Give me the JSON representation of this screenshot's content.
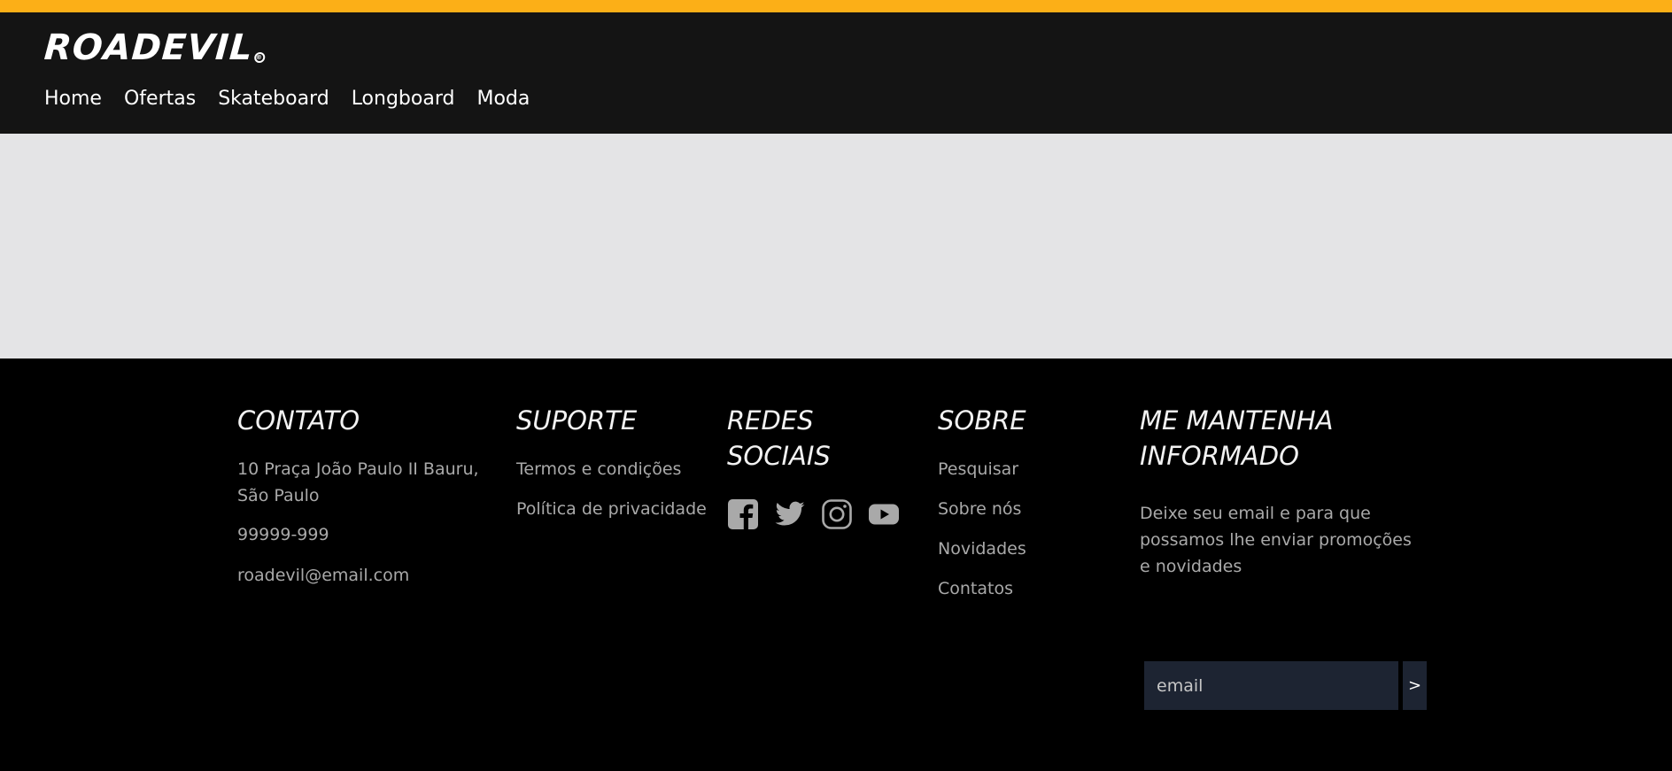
{
  "brand": {
    "logo_text": "ROADEVIL",
    "logo_mark": "®",
    "accent_color": "#fcaf17",
    "header_bg": "#141414",
    "content_bg": "#e4e4e6",
    "footer_bg": "#000000"
  },
  "nav": {
    "items": [
      "Home",
      "Ofertas",
      "Skateboard",
      "Longboard",
      "Moda"
    ]
  },
  "footer": {
    "contato": {
      "title": "CONTATO",
      "address": "10 Praça João Paulo II Bauru, São Paulo",
      "phone": "99999-999",
      "email": "roadevil@email.com"
    },
    "suporte": {
      "title": "SUPORTE",
      "links": [
        "Termos e condições",
        "Política de privacidade"
      ]
    },
    "redes": {
      "title": "REDES SOCIAIS",
      "icons": [
        "facebook-icon",
        "twitter-icon",
        "instagram-icon",
        "youtube-icon"
      ]
    },
    "sobre": {
      "title": "SOBRE",
      "links": [
        "Pesquisar",
        "Sobre nós",
        "Novidades",
        "Contatos"
      ]
    },
    "newsletter": {
      "title": "ME MANTENHA INFORMADO",
      "description": "Deixe seu email e para que possamos lhe enviar promoções e novidades",
      "placeholder": "email",
      "submit_label": ">"
    }
  }
}
